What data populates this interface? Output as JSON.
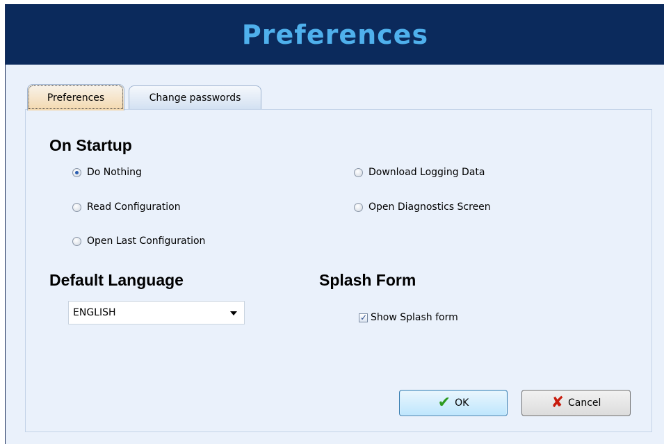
{
  "window": {
    "title": "Preferences"
  },
  "tabs": [
    {
      "label": "Preferences",
      "active": true
    },
    {
      "label": "Change passwords",
      "active": false
    }
  ],
  "startup": {
    "heading": "On Startup",
    "options": [
      {
        "label": "Do Nothing",
        "checked": true
      },
      {
        "label": "Read Configuration",
        "checked": false
      },
      {
        "label": "Open Last Configuration",
        "checked": false
      },
      {
        "label": "Download Logging Data",
        "checked": false
      },
      {
        "label": "Open Diagnostics Screen",
        "checked": false
      }
    ]
  },
  "language": {
    "heading": "Default Language",
    "selected": "ENGLISH"
  },
  "splash": {
    "heading": "Splash Form",
    "checkbox_label": "Show Splash form",
    "checked": true
  },
  "buttons": {
    "ok_label": "OK",
    "cancel_label": "Cancel"
  },
  "colors": {
    "titlebar": "#0b2a5c",
    "title_text": "#4fb0ec",
    "panel_bg": "#eaf1fb"
  }
}
